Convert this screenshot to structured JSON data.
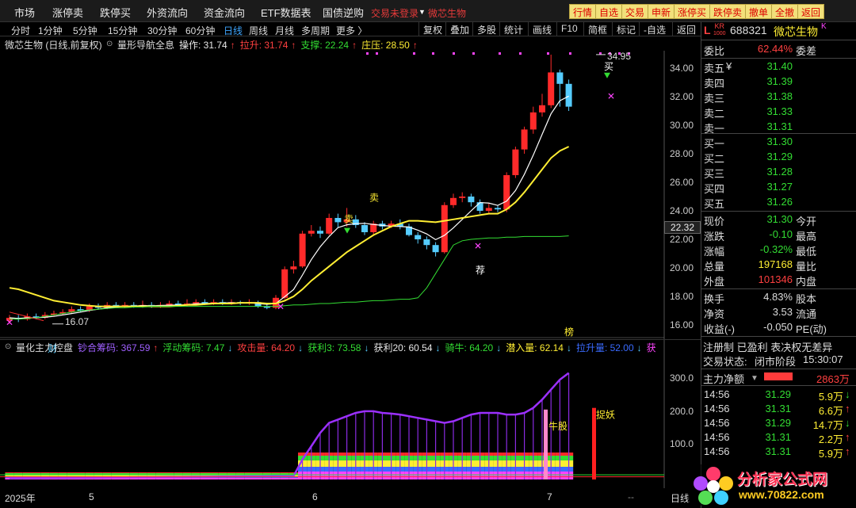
{
  "top_menu": {
    "items": [
      "市场",
      "涨停卖",
      "跌停买",
      "外资流向",
      "资金流向",
      "ETF数据表",
      "国债逆购"
    ],
    "alert_text": "交易未登录",
    "stock_name_tab": "微芯生物",
    "right_buttons": [
      "行情",
      "自选",
      "交易",
      "申新",
      "涨停买",
      "跌停卖",
      "撤单",
      "全撤",
      "返回"
    ]
  },
  "period_bar": {
    "items": [
      "分时",
      "1分钟",
      "5分钟",
      "15分钟",
      "30分钟",
      "60分钟",
      "日线",
      "周线",
      "月线",
      "多周期",
      "更多 〉"
    ],
    "active": "日线",
    "tools": [
      "复权",
      "叠加",
      "多股",
      "统计",
      "画线",
      "F10",
      "简框",
      "标记",
      "-自选",
      "返回"
    ]
  },
  "main_legend": {
    "title": "微芯生物 (日线,前复权)",
    "indicator": "量形导航全息",
    "items": [
      {
        "label": "操作: 31.74",
        "color": "#e8e8e8",
        "arrow": "↑"
      },
      {
        "label": "拉升: 31.74",
        "color": "#ff4040",
        "arrow": "↑"
      },
      {
        "label": "支撑: 22.24",
        "color": "#33dd33",
        "arrow": "↑"
      },
      {
        "label": "庄压: 28.50",
        "color": "#ffee33",
        "arrow": "↑"
      }
    ]
  },
  "main_chart": {
    "price_axis": [
      "34.00",
      "32.00",
      "30.00",
      "28.00",
      "26.00",
      "24.00",
      "22.00",
      "20.00",
      "18.00",
      "16.00"
    ],
    "current_price_tag": "22.32",
    "high_label": "34.95",
    "low_label": "16.07",
    "annotations": [
      "卖",
      "卖",
      "荐",
      "财",
      "榜",
      "买",
      "买"
    ]
  },
  "sub_legend": {
    "title": "量化主力控盘",
    "items": [
      {
        "label": "钞合筹码: 367.59",
        "color": "#a060ff",
        "arrow": "↑"
      },
      {
        "label": "浮动筹码: 7.47",
        "color": "#33dd33",
        "arrow": "↓"
      },
      {
        "label": "攻击量: 64.20",
        "color": "#ff4040",
        "arrow": "↓"
      },
      {
        "label": "获利3: 73.58",
        "color": "#33dd33",
        "arrow": "↓"
      },
      {
        "label": "获利20: 60.54",
        "color": "#e8e8e8",
        "arrow": "↓"
      },
      {
        "label": "骑牛: 64.20",
        "color": "#33dd33",
        "arrow": "↓"
      },
      {
        "label": "潜入量: 62.14",
        "color": "#ffee33",
        "arrow": "↓"
      },
      {
        "label": "拉升量: 52.00",
        "color": "#3a6bff",
        "arrow": "↓"
      },
      {
        "label": "获",
        "color": "#ff44ff",
        "arrow": ""
      }
    ]
  },
  "sub_chart": {
    "axis": [
      "300.0",
      "200.0",
      "100.0"
    ],
    "labels": [
      "牛股",
      "捉妖"
    ]
  },
  "x_axis": {
    "labels": [
      "2025年",
      "5",
      "6",
      "7",
      "--"
    ],
    "mode": "日线"
  },
  "quote_panel": {
    "prefix": "L",
    "badge_top": "KR",
    "badge_bottom": "1000",
    "code": "688321",
    "name": "微芯生物",
    "suffix": "K",
    "weibi_label": "委比",
    "weibi_value": "62.44%",
    "weicha_label": "委差",
    "sells": [
      {
        "label": "卖五",
        "extra": "¥",
        "price": "31.40"
      },
      {
        "label": "卖四",
        "extra": "",
        "price": "31.39"
      },
      {
        "label": "卖三",
        "extra": "",
        "price": "31.38"
      },
      {
        "label": "卖二",
        "extra": "",
        "price": "31.33"
      },
      {
        "label": "卖一",
        "extra": "",
        "price": "31.31"
      }
    ],
    "buys": [
      {
        "label": "买一",
        "price": "31.30"
      },
      {
        "label": "买二",
        "price": "31.29"
      },
      {
        "label": "买三",
        "price": "31.28"
      },
      {
        "label": "买四",
        "price": "31.27"
      },
      {
        "label": "买五",
        "price": "31.26"
      }
    ],
    "stats": [
      {
        "label": "现价",
        "value": "31.30",
        "label2": "今开",
        "color": "#33dd33"
      },
      {
        "label": "涨跌",
        "value": "-0.10",
        "label2": "最高",
        "color": "#33dd33"
      },
      {
        "label": "涨幅",
        "value": "-0.32%",
        "label2": "最低",
        "color": "#33dd33"
      },
      {
        "label": "总量",
        "value": "197168",
        "label2": "量比",
        "color": "#ffee33"
      },
      {
        "label": "外盘",
        "value": "101346",
        "label2": "内盘",
        "color": "#ff4040"
      }
    ],
    "stats2": [
      {
        "label": "换手",
        "value": "4.83%",
        "label2": "股本"
      },
      {
        "label": "净资",
        "value": "3.53",
        "label2": "流通"
      },
      {
        "label": "收益(-)",
        "value": "-0.050",
        "label2": "PE(动)"
      }
    ],
    "tags": "注册制 已盈利 表决权无差异",
    "trade_status_label": "交易状态:",
    "trade_status": "闭市阶段",
    "trade_time": "15:30:07",
    "net_flow_label": "主力净额",
    "net_flow_value": "2863万",
    "ticks": [
      {
        "time": "14:56",
        "price": "31.29",
        "vol": "5.9万",
        "arrow": "↓"
      },
      {
        "time": "14:56",
        "price": "31.31",
        "vol": "6.6万",
        "arrow": "↑"
      },
      {
        "time": "14:56",
        "price": "31.29",
        "vol": "14.7万",
        "arrow": "↓"
      },
      {
        "time": "14:56",
        "price": "31.31",
        "vol": "2.2万",
        "arrow": "↑"
      },
      {
        "time": "14:56",
        "price": "31.31",
        "vol": "5.9万",
        "arrow": "↑"
      }
    ]
  },
  "watermark": {
    "title": "分析家公式网",
    "url": "www.70822.com"
  },
  "colors": {
    "up": "#ff2a2a",
    "down": "#55ccff",
    "ma_white": "#ffffff",
    "ma_yellow": "#ffee33",
    "support_green": "#33dd33",
    "purple": "#9b30ff"
  }
}
